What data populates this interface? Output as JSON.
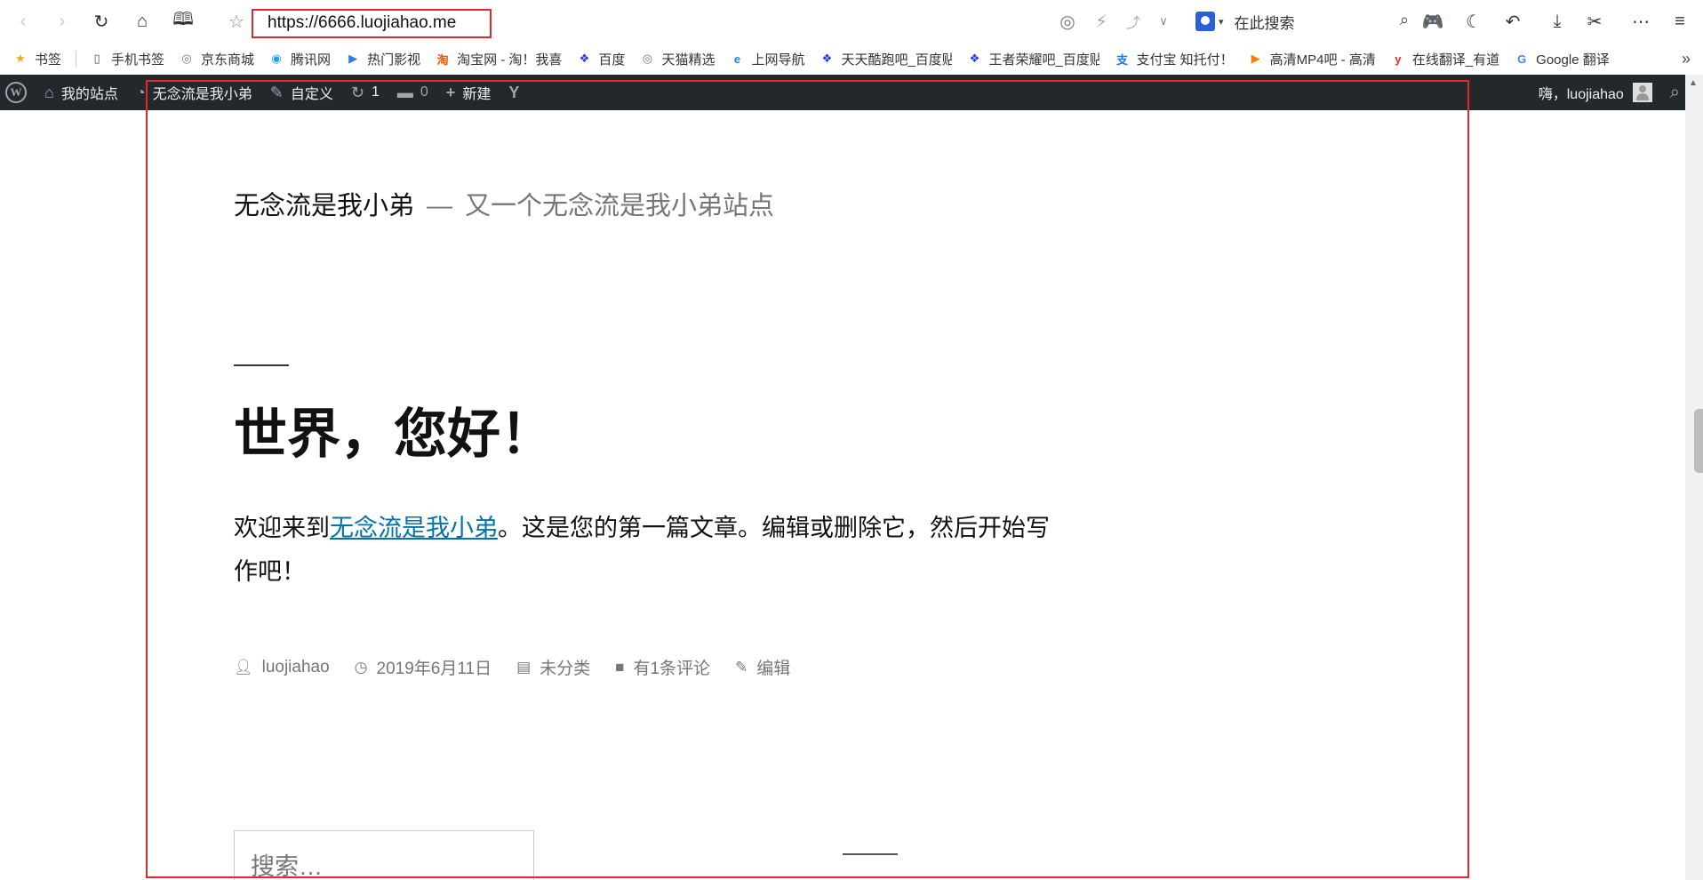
{
  "browser": {
    "url": "https://6666.luojiahao.me",
    "search_placeholder": "在此搜索"
  },
  "bookmarks": [
    {
      "label": "书签",
      "icon": "star-icon",
      "color": "#f5a623"
    },
    {
      "label": "手机书签",
      "icon": "phone-icon",
      "color": "#555555"
    },
    {
      "label": "京东商城",
      "icon": "globe-icon",
      "color": "#777777"
    },
    {
      "label": "腾讯网",
      "icon": "tencent-icon",
      "color": "#1fa1e6"
    },
    {
      "label": "热门影视",
      "icon": "play-icon",
      "color": "#2a7de1"
    },
    {
      "label": "淘宝网 - 淘！我喜",
      "icon": "taobao-icon",
      "color": "#ff5000"
    },
    {
      "label": "百度",
      "icon": "baidu-paw-icon",
      "color": "#2932e1"
    },
    {
      "label": "天猫精选",
      "icon": "globe-icon",
      "color": "#777777"
    },
    {
      "label": "上网导航",
      "icon": "ie-icon",
      "color": "#1e88e5"
    },
    {
      "label": "天天酷跑吧_百度贴",
      "icon": "baidu-paw-icon",
      "color": "#2932e1"
    },
    {
      "label": "王者荣耀吧_百度贴",
      "icon": "baidu-paw-icon",
      "color": "#2932e1"
    },
    {
      "label": "支付宝 知托付！",
      "icon": "alipay-icon",
      "color": "#1677ff"
    },
    {
      "label": "高清MP4吧 - 高清",
      "icon": "video-icon",
      "color": "#ff7a00"
    },
    {
      "label": "在线翻译_有道",
      "icon": "youdao-icon",
      "color": "#e0282f"
    },
    {
      "label": "Google 翻译",
      "icon": "translate-icon",
      "color": "#4285f4"
    }
  ],
  "adminbar": {
    "my_site": "我的站点",
    "site_name": "无念流是我小弟",
    "customize": "自定义",
    "updates_count": "1",
    "comments_count": "0",
    "new_label": "新建",
    "greeting": "嗨，luojiahao"
  },
  "site": {
    "title": "无念流是我小弟",
    "separator": "—",
    "description": "又一个无念流是我小弟站点"
  },
  "post": {
    "title": "世界，您好！",
    "content_before": "欢迎来到",
    "content_link": "无念流是我小弟",
    "content_after": "。这是您的第一篇文章。编辑或删除它，然后开始写作吧！",
    "author": "luojiahao",
    "date": "2019年6月11日",
    "category": "未分类",
    "comments": "有1条评论",
    "edit": "编辑"
  },
  "widget": {
    "search_placeholder": "搜索…"
  },
  "colors": {
    "adminbar_bg": "#23282d",
    "link": "#0073aa",
    "highlight": "#e0282f",
    "meta_text": "#767676"
  }
}
